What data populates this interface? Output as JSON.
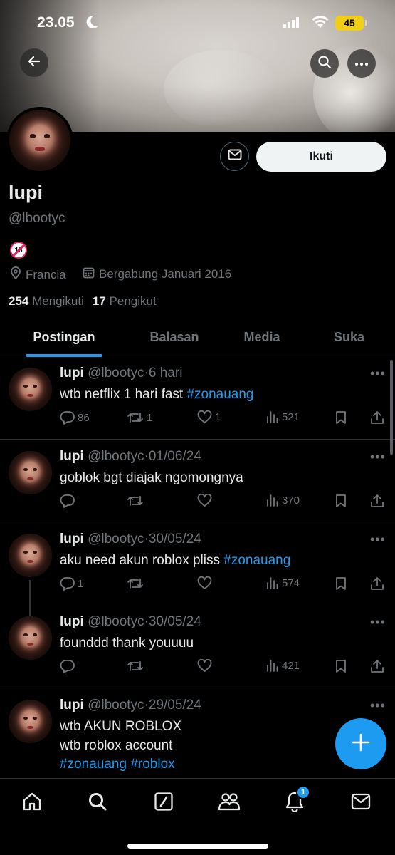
{
  "status_bar": {
    "time": "23.05",
    "battery": "45"
  },
  "profile": {
    "name": "lupi",
    "handle": "@lbootyc",
    "bio_emoji": "18",
    "location": "Francia",
    "joined": "Bergabung Januari 2016",
    "following_count": "254",
    "following_label": "Mengikuti",
    "followers_count": "17",
    "followers_label": "Pengikut",
    "follow_button": "Ikuti"
  },
  "tabs": [
    "Postingan",
    "Balasan",
    "Media",
    "Suka"
  ],
  "posts": [
    {
      "name": "lupi",
      "handle": "@lbootyc",
      "sep": "·",
      "date": "6 hari",
      "text": "wtb netflix 1 hari fast ",
      "tag": "#zonauang",
      "replies": "86",
      "reposts": "1",
      "likes": "1",
      "views": "521"
    },
    {
      "name": "lupi",
      "handle": "@lbootyc",
      "sep": "·",
      "date": "01/06/24",
      "text": "goblok bgt diajak ngomongnya",
      "tag": "",
      "replies": "",
      "reposts": "",
      "likes": "",
      "views": "370"
    },
    {
      "name": "lupi",
      "handle": "@lbootyc",
      "sep": "·",
      "date": "30/05/24",
      "text": "aku need akun roblox pliss ",
      "tag": "#zonauang",
      "replies": "1",
      "reposts": "",
      "likes": "",
      "views": "574"
    },
    {
      "name": "lupi",
      "handle": "@lbootyc",
      "sep": "·",
      "date": "30/05/24",
      "text": "founddd thank youuuu",
      "tag": "",
      "replies": "",
      "reposts": "",
      "likes": "",
      "views": "421"
    },
    {
      "name": "lupi",
      "handle": "@lbootyc",
      "sep": "·",
      "date": "29/05/24",
      "line1": "wtb AKUN ROBLOX",
      "line2": "wtb roblox account",
      "tags": "#zonauang #roblox"
    }
  ],
  "notification_badge": "1",
  "icons": {
    "back": "arrow-left-icon",
    "search": "search-icon",
    "more": "more-icon",
    "message": "envelope-icon",
    "location": "location-pin-icon",
    "calendar": "calendar-icon",
    "reply": "reply-icon",
    "repost": "repost-icon",
    "like": "heart-icon",
    "views": "views-icon",
    "bookmark": "bookmark-icon",
    "share": "share-icon",
    "compose": "plus-icon",
    "nav": [
      "home-icon",
      "search-icon",
      "grok-icon",
      "communities-icon",
      "bell-icon",
      "messages-icon"
    ]
  },
  "colors": {
    "accent": "#1d9bf0",
    "background": "#000000",
    "secondary_text": "#71767b",
    "battery": "#f2cd16"
  }
}
